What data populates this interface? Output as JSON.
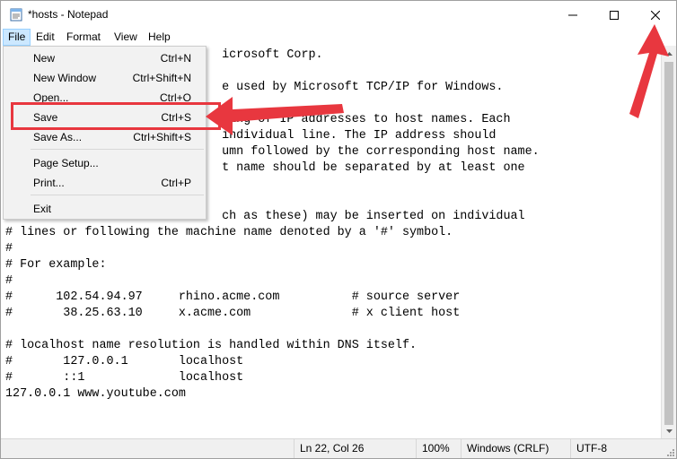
{
  "window": {
    "title": "*hosts - Notepad"
  },
  "menubar": [
    "File",
    "Edit",
    "Format",
    "View",
    "Help"
  ],
  "file_menu": {
    "new": {
      "label": "New",
      "shortcut": "Ctrl+N"
    },
    "new_window": {
      "label": "New Window",
      "shortcut": "Ctrl+Shift+N"
    },
    "open": {
      "label": "Open...",
      "shortcut": "Ctrl+O"
    },
    "save": {
      "label": "Save",
      "shortcut": "Ctrl+S"
    },
    "save_as": {
      "label": "Save As...",
      "shortcut": "Ctrl+Shift+S"
    },
    "page_setup": {
      "label": "Page Setup..."
    },
    "print": {
      "label": "Print...",
      "shortcut": "Ctrl+P"
    },
    "exit": {
      "label": "Exit"
    }
  },
  "editor": {
    "lines": [
      "                              icrosoft Corp.",
      "",
      "                              e used by Microsoft TCP/IP for Windows.",
      "",
      "                              ping of IP addresses to host names. Each",
      "                              individual line. The IP address should",
      "                              umn followed by the corresponding host name.",
      "                              t name should be separated by at least one",
      "",
      "",
      "                              ch as these) may be inserted on individual",
      "# lines or following the machine name denoted by a '#' symbol.",
      "#",
      "# For example:",
      "#",
      "#      102.54.94.97     rhino.acme.com          # source server",
      "#       38.25.63.10     x.acme.com              # x client host",
      "",
      "# localhost name resolution is handled within DNS itself.",
      "#       127.0.0.1       localhost",
      "#       ::1             localhost",
      "127.0.0.1 www.youtube.com"
    ]
  },
  "statusbar": {
    "position": "Ln 22, Col 26",
    "zoom": "100%",
    "line_endings": "Windows (CRLF)",
    "encoding": "UTF-8"
  },
  "annotation_color": "#e8373f"
}
